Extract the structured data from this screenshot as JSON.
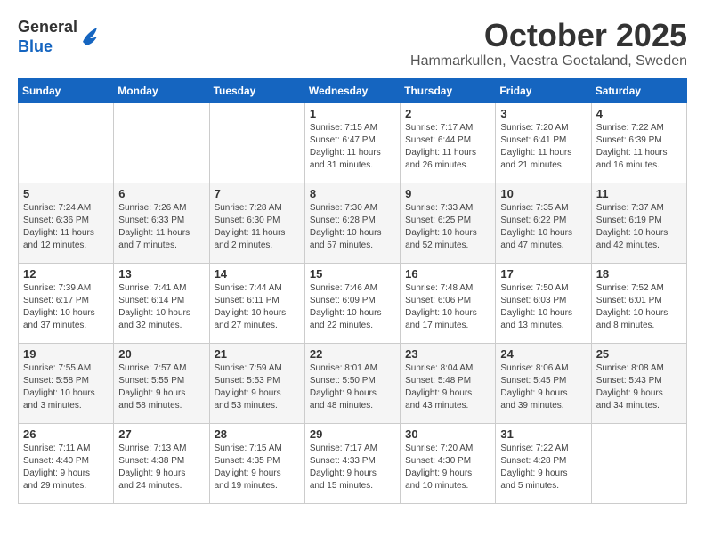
{
  "header": {
    "logo_general": "General",
    "logo_blue": "Blue",
    "month_title": "October 2025",
    "location": "Hammarkullen, Vaestra Goetaland, Sweden"
  },
  "days_of_week": [
    "Sunday",
    "Monday",
    "Tuesday",
    "Wednesday",
    "Thursday",
    "Friday",
    "Saturday"
  ],
  "weeks": [
    [
      {
        "day": "",
        "info": ""
      },
      {
        "day": "",
        "info": ""
      },
      {
        "day": "",
        "info": ""
      },
      {
        "day": "1",
        "info": "Sunrise: 7:15 AM\nSunset: 6:47 PM\nDaylight: 11 hours\nand 31 minutes."
      },
      {
        "day": "2",
        "info": "Sunrise: 7:17 AM\nSunset: 6:44 PM\nDaylight: 11 hours\nand 26 minutes."
      },
      {
        "day": "3",
        "info": "Sunrise: 7:20 AM\nSunset: 6:41 PM\nDaylight: 11 hours\nand 21 minutes."
      },
      {
        "day": "4",
        "info": "Sunrise: 7:22 AM\nSunset: 6:39 PM\nDaylight: 11 hours\nand 16 minutes."
      }
    ],
    [
      {
        "day": "5",
        "info": "Sunrise: 7:24 AM\nSunset: 6:36 PM\nDaylight: 11 hours\nand 12 minutes."
      },
      {
        "day": "6",
        "info": "Sunrise: 7:26 AM\nSunset: 6:33 PM\nDaylight: 11 hours\nand 7 minutes."
      },
      {
        "day": "7",
        "info": "Sunrise: 7:28 AM\nSunset: 6:30 PM\nDaylight: 11 hours\nand 2 minutes."
      },
      {
        "day": "8",
        "info": "Sunrise: 7:30 AM\nSunset: 6:28 PM\nDaylight: 10 hours\nand 57 minutes."
      },
      {
        "day": "9",
        "info": "Sunrise: 7:33 AM\nSunset: 6:25 PM\nDaylight: 10 hours\nand 52 minutes."
      },
      {
        "day": "10",
        "info": "Sunrise: 7:35 AM\nSunset: 6:22 PM\nDaylight: 10 hours\nand 47 minutes."
      },
      {
        "day": "11",
        "info": "Sunrise: 7:37 AM\nSunset: 6:19 PM\nDaylight: 10 hours\nand 42 minutes."
      }
    ],
    [
      {
        "day": "12",
        "info": "Sunrise: 7:39 AM\nSunset: 6:17 PM\nDaylight: 10 hours\nand 37 minutes."
      },
      {
        "day": "13",
        "info": "Sunrise: 7:41 AM\nSunset: 6:14 PM\nDaylight: 10 hours\nand 32 minutes."
      },
      {
        "day": "14",
        "info": "Sunrise: 7:44 AM\nSunset: 6:11 PM\nDaylight: 10 hours\nand 27 minutes."
      },
      {
        "day": "15",
        "info": "Sunrise: 7:46 AM\nSunset: 6:09 PM\nDaylight: 10 hours\nand 22 minutes."
      },
      {
        "day": "16",
        "info": "Sunrise: 7:48 AM\nSunset: 6:06 PM\nDaylight: 10 hours\nand 17 minutes."
      },
      {
        "day": "17",
        "info": "Sunrise: 7:50 AM\nSunset: 6:03 PM\nDaylight: 10 hours\nand 13 minutes."
      },
      {
        "day": "18",
        "info": "Sunrise: 7:52 AM\nSunset: 6:01 PM\nDaylight: 10 hours\nand 8 minutes."
      }
    ],
    [
      {
        "day": "19",
        "info": "Sunrise: 7:55 AM\nSunset: 5:58 PM\nDaylight: 10 hours\nand 3 minutes."
      },
      {
        "day": "20",
        "info": "Sunrise: 7:57 AM\nSunset: 5:55 PM\nDaylight: 9 hours\nand 58 minutes."
      },
      {
        "day": "21",
        "info": "Sunrise: 7:59 AM\nSunset: 5:53 PM\nDaylight: 9 hours\nand 53 minutes."
      },
      {
        "day": "22",
        "info": "Sunrise: 8:01 AM\nSunset: 5:50 PM\nDaylight: 9 hours\nand 48 minutes."
      },
      {
        "day": "23",
        "info": "Sunrise: 8:04 AM\nSunset: 5:48 PM\nDaylight: 9 hours\nand 43 minutes."
      },
      {
        "day": "24",
        "info": "Sunrise: 8:06 AM\nSunset: 5:45 PM\nDaylight: 9 hours\nand 39 minutes."
      },
      {
        "day": "25",
        "info": "Sunrise: 8:08 AM\nSunset: 5:43 PM\nDaylight: 9 hours\nand 34 minutes."
      }
    ],
    [
      {
        "day": "26",
        "info": "Sunrise: 7:11 AM\nSunset: 4:40 PM\nDaylight: 9 hours\nand 29 minutes."
      },
      {
        "day": "27",
        "info": "Sunrise: 7:13 AM\nSunset: 4:38 PM\nDaylight: 9 hours\nand 24 minutes."
      },
      {
        "day": "28",
        "info": "Sunrise: 7:15 AM\nSunset: 4:35 PM\nDaylight: 9 hours\nand 19 minutes."
      },
      {
        "day": "29",
        "info": "Sunrise: 7:17 AM\nSunset: 4:33 PM\nDaylight: 9 hours\nand 15 minutes."
      },
      {
        "day": "30",
        "info": "Sunrise: 7:20 AM\nSunset: 4:30 PM\nDaylight: 9 hours\nand 10 minutes."
      },
      {
        "day": "31",
        "info": "Sunrise: 7:22 AM\nSunset: 4:28 PM\nDaylight: 9 hours\nand 5 minutes."
      },
      {
        "day": "",
        "info": ""
      }
    ]
  ]
}
